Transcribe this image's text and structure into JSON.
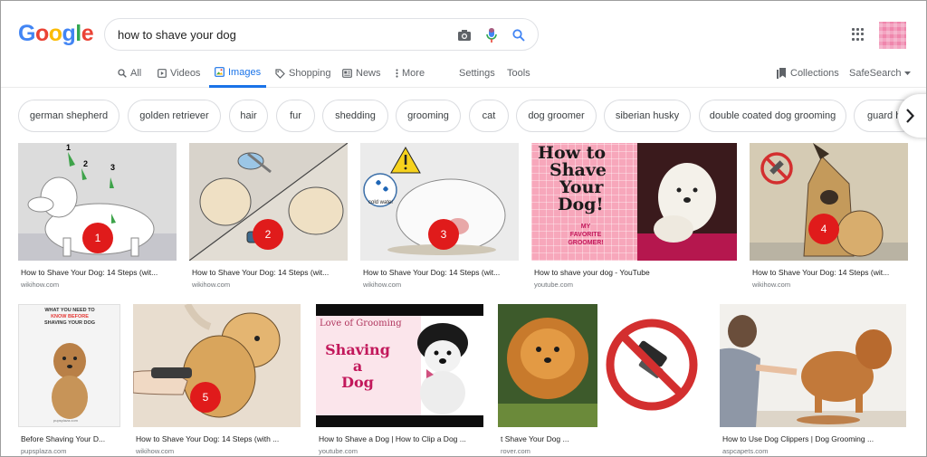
{
  "logo": {
    "letters": [
      "G",
      "o",
      "o",
      "g",
      "l",
      "e"
    ],
    "colors": [
      "#4285f4",
      "#ea4335",
      "#fbbc05",
      "#4285f4",
      "#34a853",
      "#ea4335"
    ]
  },
  "search": {
    "query": "how to shave your dog",
    "placeholder": ""
  },
  "tabs": [
    {
      "label": "All",
      "icon": "search-icon"
    },
    {
      "label": "Videos",
      "icon": "video-icon"
    },
    {
      "label": "Images",
      "icon": "image-icon",
      "active": true
    },
    {
      "label": "Shopping",
      "icon": "tag-icon"
    },
    {
      "label": "News",
      "icon": "news-icon"
    },
    {
      "label": "More",
      "icon": "more-vert-icon"
    },
    {
      "label": "Settings"
    },
    {
      "label": "Tools"
    }
  ],
  "right_tabs": {
    "collections": "Collections",
    "safesearch": "SafeSearch"
  },
  "chips": [
    "german shepherd",
    "golden retriever",
    "hair",
    "fur",
    "shedding",
    "grooming",
    "cat",
    "dog groomer",
    "siberian husky",
    "double coated dog grooming",
    "guard h"
  ],
  "results": [
    {
      "caption": "How to Shave Your Dog: 14 Steps (wit...",
      "source": "wikihow.com",
      "badge": "1",
      "labels": [
        "1",
        "2",
        "3"
      ]
    },
    {
      "caption": "How to Shave Your Dog: 14 Steps (wit...",
      "source": "wikihow.com",
      "badge": "2"
    },
    {
      "caption": "How to Shave Your Dog: 14 Steps (wit...",
      "source": "wikihow.com",
      "badge": "3",
      "label": "cold water"
    },
    {
      "caption": "How to shave your dog - YouTube",
      "source": "youtube.com",
      "title_lines": [
        "How to",
        "Shave",
        "Your",
        "Dog!"
      ],
      "sub": [
        "MY",
        "FAVORITE",
        "GROOMER!"
      ]
    },
    {
      "caption": "How to Shave Your Dog: 14 Steps (wit...",
      "source": "wikihow.com",
      "badge": "4"
    },
    {
      "caption": "Before Shaving Your D...",
      "source": "pupsplaza.com",
      "title_lines": [
        "WHAT YOU NEED TO",
        "KNOW BEFORE",
        "SHAVING YOUR DOG"
      ],
      "sub": [
        "pupsplaza.com"
      ]
    },
    {
      "caption": "How to Shave Your Dog: 14 Steps (with ...",
      "source": "wikihow.com",
      "badge": "5"
    },
    {
      "caption": "How to Shave a Dog | How to Clip a Dog ...",
      "source": "youtube.com",
      "title_lines": [
        "Love of Grooming",
        "Shaving a",
        "Dog"
      ]
    },
    {
      "caption": "t Shave Your Dog ...",
      "source": "rover.com"
    },
    {
      "caption": "How to Use Dog Clippers | Dog Grooming ...",
      "source": "aspcapets.com"
    }
  ]
}
